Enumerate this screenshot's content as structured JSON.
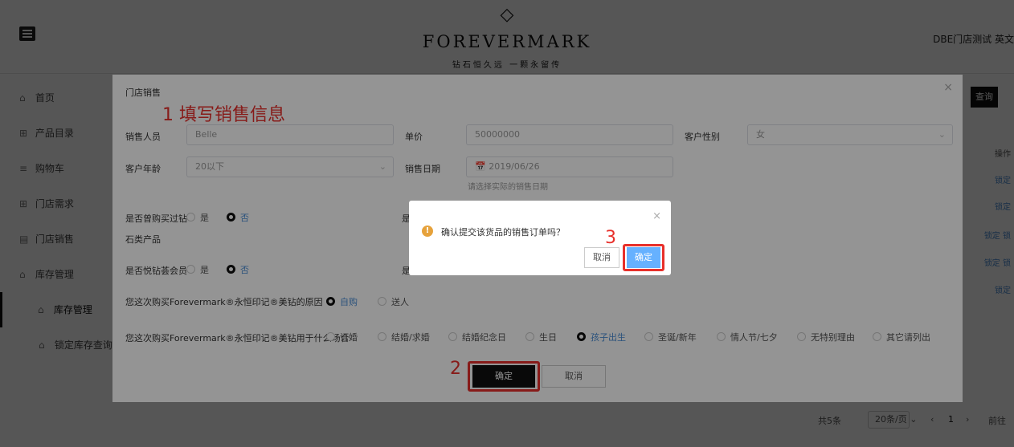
{
  "header": {
    "logo_mark": "◇",
    "logo_text": "FOREVERMARK",
    "logo_sub": "钻石恒久远 一颗永留传",
    "store": "DBE门店测试 英文"
  },
  "sidebar": {
    "items": [
      {
        "icon": "home-icon",
        "glyph": "⌂",
        "label": "首页"
      },
      {
        "icon": "grid-icon",
        "glyph": "⊞",
        "label": "产品目录"
      },
      {
        "icon": "cart-icon",
        "glyph": "≡",
        "label": "购物车"
      },
      {
        "icon": "grid-icon",
        "glyph": "⊞",
        "label": "门店需求"
      },
      {
        "icon": "store-icon",
        "glyph": "▤",
        "label": "门店销售"
      },
      {
        "icon": "warehouse-icon",
        "glyph": "⌂",
        "label": "库存管理"
      }
    ],
    "sub_items": [
      {
        "label": "库存管理"
      },
      {
        "label": "锁定库存查询"
      }
    ]
  },
  "page": {
    "query_button": "查询",
    "op_header": "操作",
    "row_actions": [
      "锁定",
      "锁定",
      "锁定 锁",
      "锁定 锁",
      "锁定"
    ],
    "pager": {
      "total": "共5条",
      "page_size": "20条/页",
      "prev": "‹",
      "current": "1",
      "next": "›",
      "goto": "前往"
    }
  },
  "modal": {
    "title": "门店销售",
    "close": "×",
    "annotation_1": "1 填写销售信息",
    "annotation_2": "2",
    "annotation_3": "3",
    "sales_person_label": "销售人员",
    "sales_person_value": "Belle",
    "price_label": "单价",
    "price_value": "50000000",
    "gender_label": "客户性别",
    "gender_value": "女",
    "age_label": "客户年龄",
    "age_value": "20以下",
    "date_label": "销售日期",
    "date_value": "📅 2019/06/26",
    "date_hint": "请选择实际的销售日期",
    "bought_label": "是否曾购买过钻",
    "bought_yes": "是",
    "bought_no": "否",
    "stone_label": "石类产品",
    "member_label": "是否悦钻荟会员",
    "member_yes": "是",
    "member_no": "否",
    "hidden_label_initial": "是",
    "reason_label": "您这次购买Forevermark®永恒印记®美钻的原因",
    "reason_options": [
      {
        "label": "自购",
        "selected": true
      },
      {
        "label": "送人",
        "selected": false
      }
    ],
    "occasion_label": "您这次购买Forevermark®永恒印记®美钻用于什么场合",
    "occasion_options": [
      {
        "label": "订婚",
        "selected": false
      },
      {
        "label": "结婚/求婚",
        "selected": false
      },
      {
        "label": "结婚纪念日",
        "selected": false
      },
      {
        "label": "生日",
        "selected": false
      },
      {
        "label": "孩子出生",
        "selected": true
      },
      {
        "label": "圣诞/新年",
        "selected": false
      },
      {
        "label": "情人节/七夕",
        "selected": false
      },
      {
        "label": "无特别理由",
        "selected": false
      },
      {
        "label": "其它请列出",
        "selected": false
      }
    ],
    "confirm_button": "确定",
    "cancel_button": "取消"
  },
  "confirm_dialog": {
    "icon_glyph": "!",
    "message": "确认提交该货品的销售订单吗？",
    "close": "×",
    "cancel_button": "取消",
    "ok_button": "确定"
  },
  "colors": {
    "accent": "#4a8ed6",
    "annotation": "#e8302b",
    "warning": "#e6a23c",
    "primary_dark": "#111111"
  }
}
